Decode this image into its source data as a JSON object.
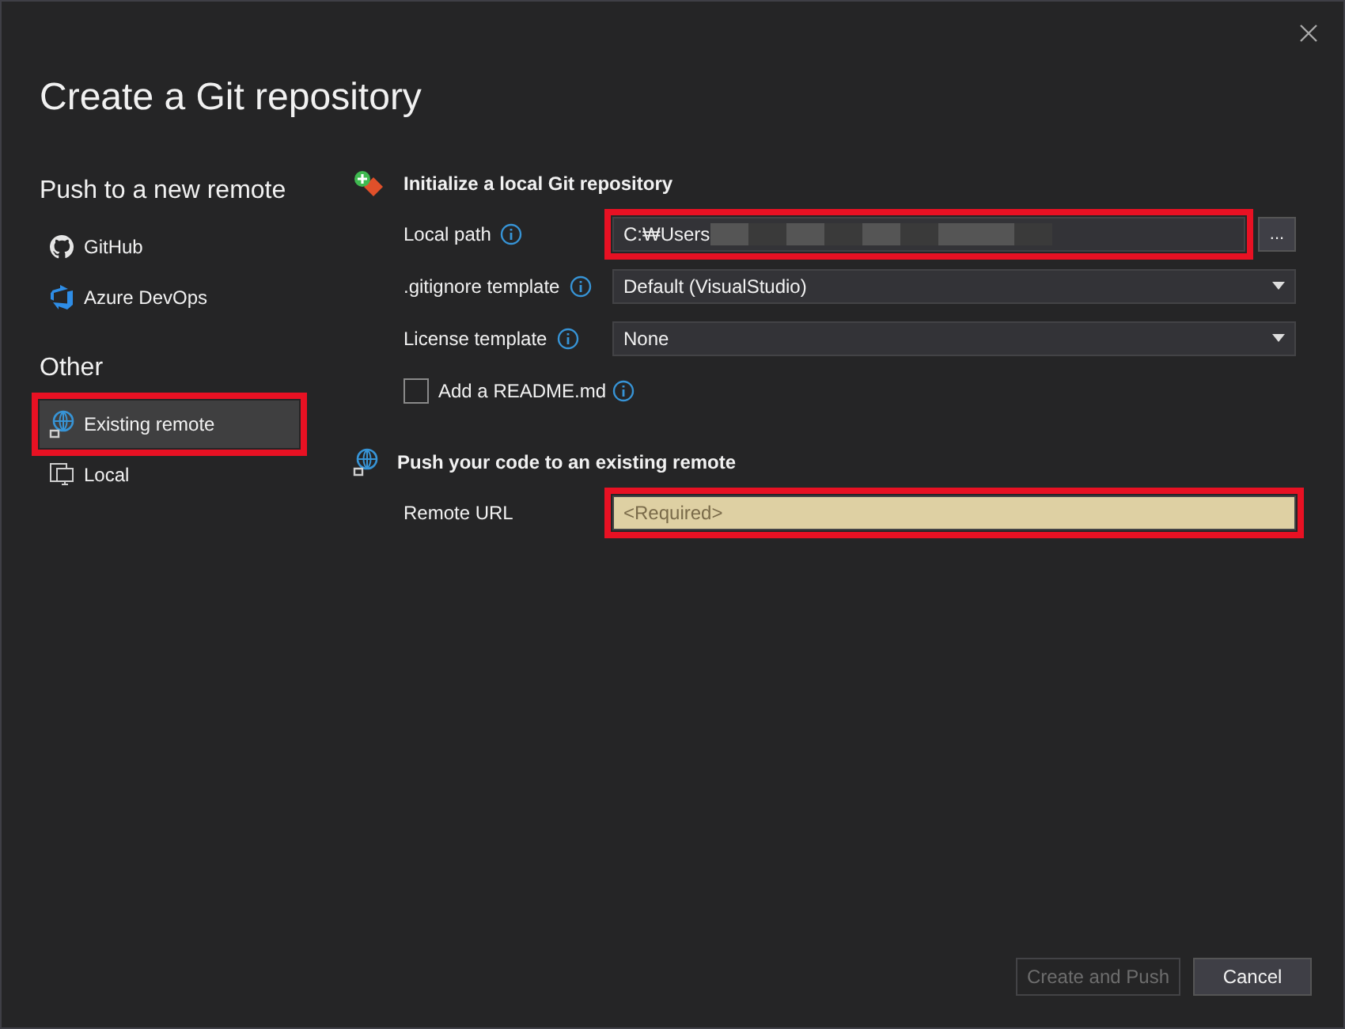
{
  "window": {
    "title": "Create a Git repository"
  },
  "sidebar": {
    "groups": [
      {
        "heading": "Push to a new remote",
        "items": [
          {
            "label": "GitHub",
            "selected": false,
            "highlighted": false
          },
          {
            "label": "Azure DevOps",
            "selected": false,
            "highlighted": false
          }
        ]
      },
      {
        "heading": "Other",
        "items": [
          {
            "label": "Existing remote",
            "selected": true,
            "highlighted": true
          },
          {
            "label": "Local",
            "selected": false,
            "highlighted": false
          }
        ]
      }
    ]
  },
  "sections": [
    {
      "title": "Initialize a local Git repository",
      "fields": [
        {
          "kind": "path",
          "label": "Local path",
          "info": true,
          "value": "C:₩Users",
          "redacted": true,
          "highlighted": true,
          "browse": "..."
        },
        {
          "kind": "select",
          "label": ".gitignore template",
          "info": true,
          "value": "Default (VisualStudio)"
        },
        {
          "kind": "select",
          "label": "License template",
          "info": true,
          "value": "None"
        },
        {
          "kind": "checkbox",
          "label": "Add a README.md",
          "info": true,
          "checked": false
        }
      ]
    },
    {
      "title": "Push your code to an existing remote",
      "fields": [
        {
          "kind": "text",
          "label": "Remote URL",
          "placeholder": "<Required>",
          "required": true,
          "highlighted": true
        }
      ]
    }
  ],
  "buttons": [
    {
      "label": "Create and Push",
      "disabled": true
    },
    {
      "label": "Cancel",
      "disabled": false
    }
  ]
}
